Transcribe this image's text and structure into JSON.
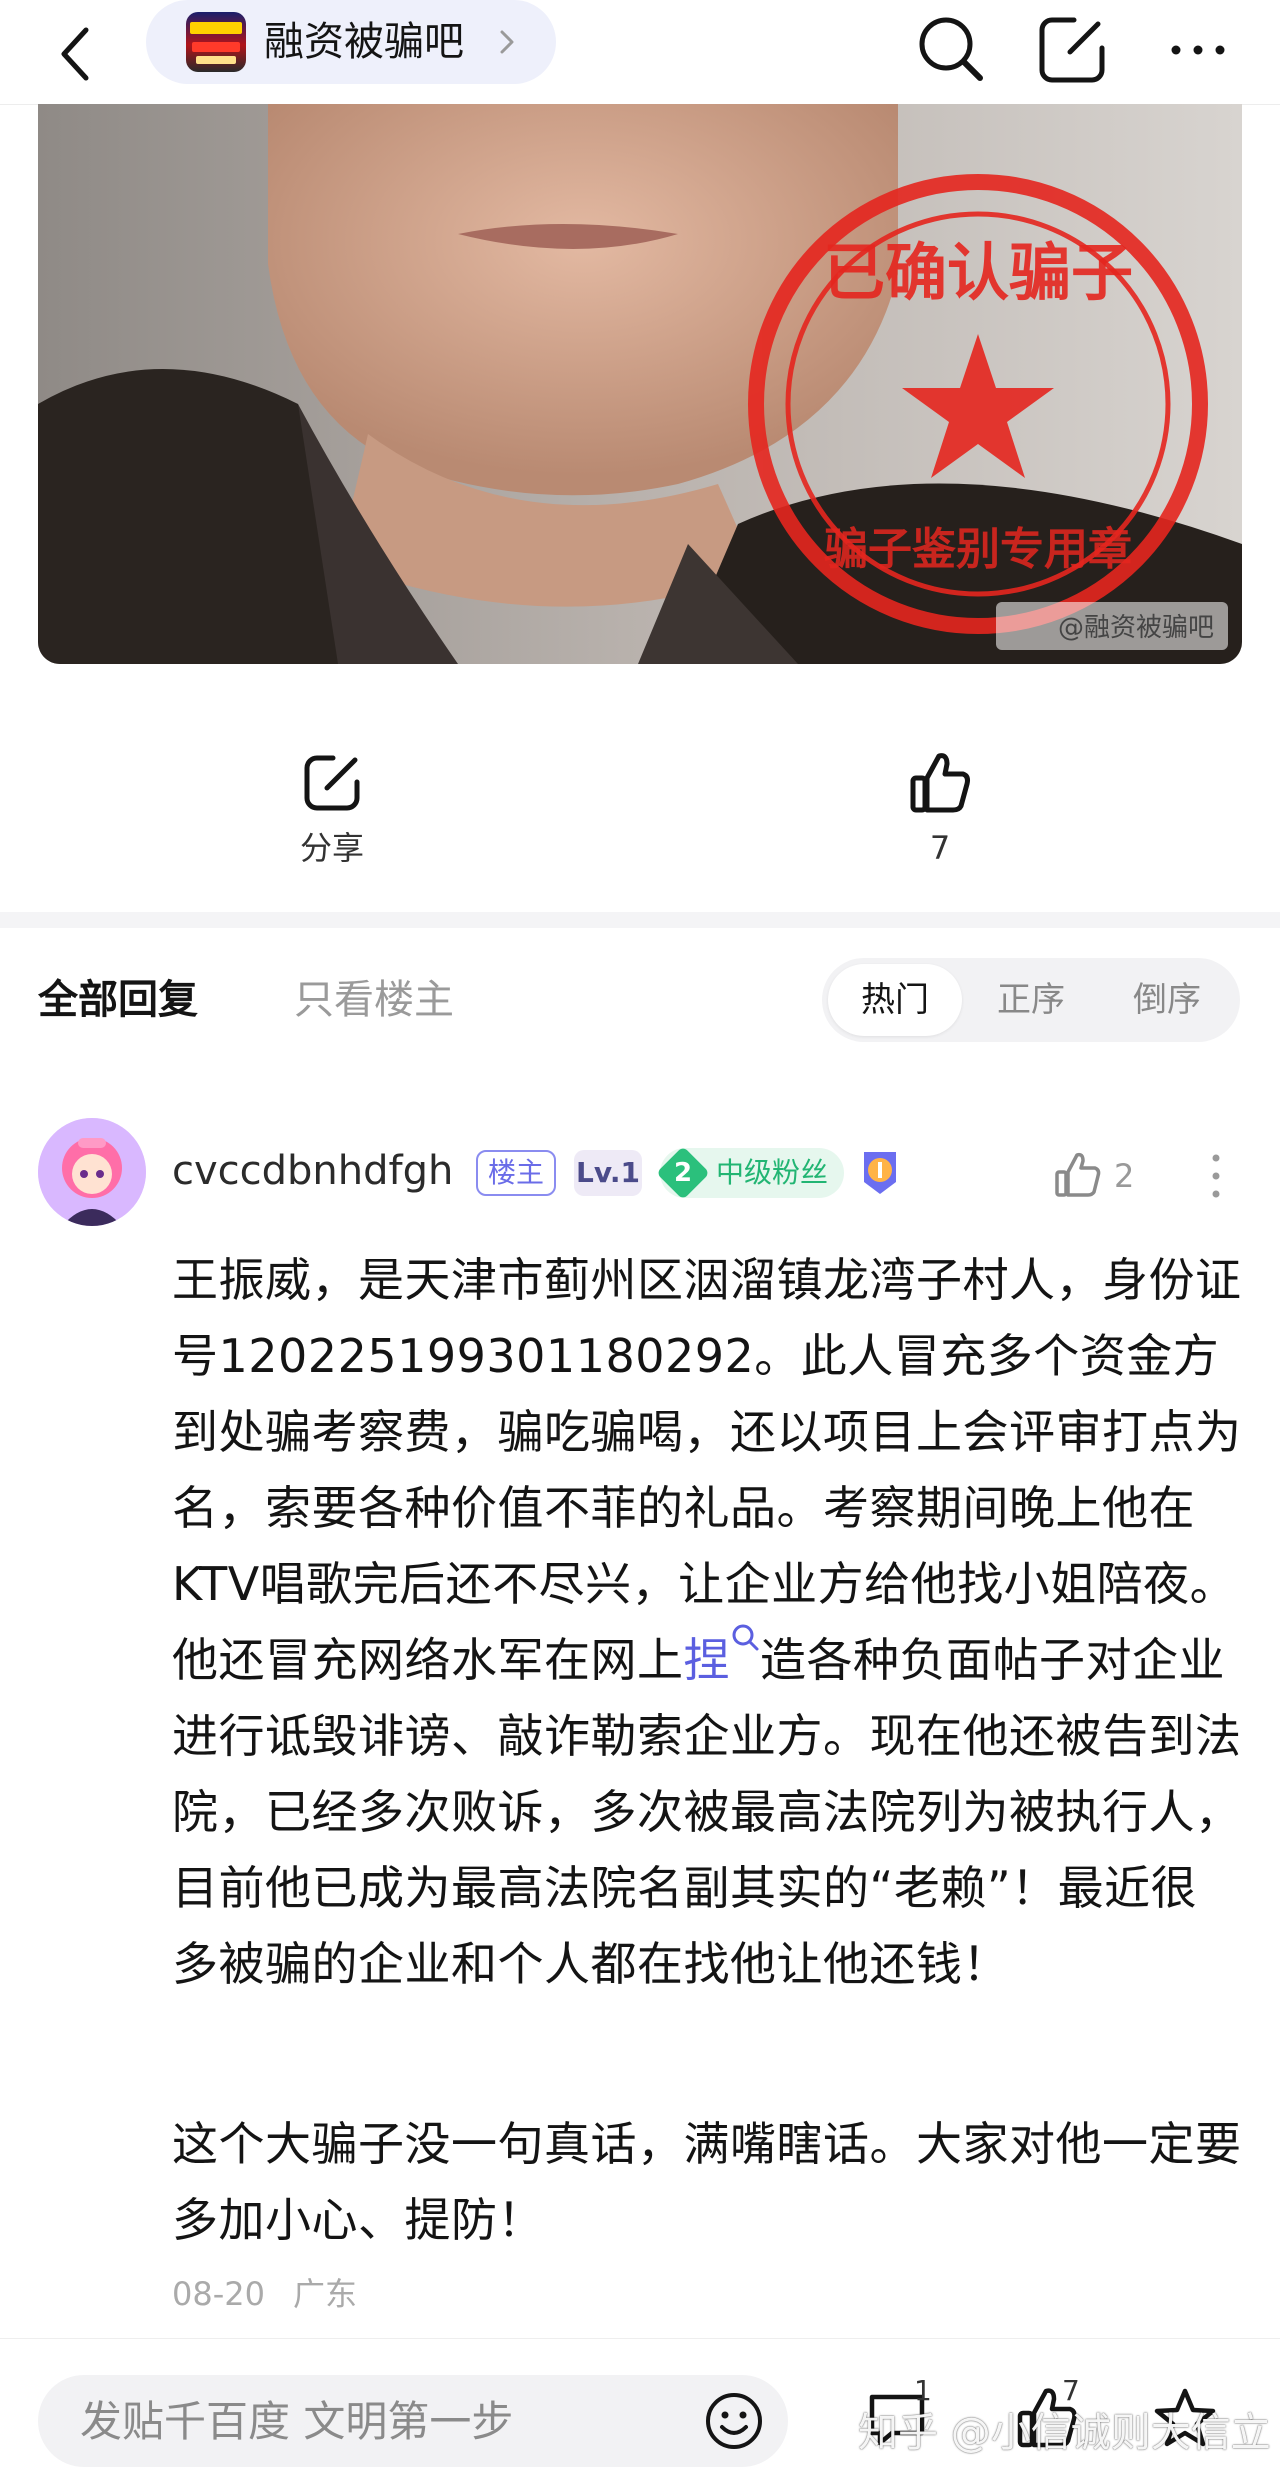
{
  "header": {
    "forum_name": "融资被骗吧"
  },
  "hero": {
    "stamp_top_text": "已确认骗子",
    "stamp_bottom_text": "骗子鉴别专用章",
    "source_mark": "@融资被骗吧"
  },
  "actions": {
    "share_label": "分享",
    "like_count": "7"
  },
  "replies_header": {
    "tab_all": "全部回复",
    "tab_op_only": "只看楼主",
    "sort_options": [
      "热门",
      "正序",
      "倒序"
    ],
    "sort_active": "热门"
  },
  "reply": {
    "username": "cvccdbnhdfgh",
    "badge_op": "楼主",
    "level": "Lv.1",
    "fan_level_num": "2",
    "fan_label": "中级粉丝",
    "like_count": "2",
    "paragraph1": "王振威，是天津市蓟州区洇溜镇龙湾子村人，身份证号120225199301180292。此人冒充多个资金方到处骗考察费，骗吃骗喝，还以项目上会评审打点为名，索要各种价值不菲的礼品。考察期间晚上他在KTV唱歌完后还不尽兴，让企业方给他找小姐陪夜。他还冒充网络水军在网上",
    "paragraph1_link": "捏",
    "paragraph1_rest": "造各种负面帖子对企业进行诋毁诽谤、敲诈勒索企业方。现在他还被告到法院，已经多次败诉，多次被最高法院列为被执行人，目前他已成为最高法院名副其实的“老赖”！最近很多被骗的企业和个人都在找他让他还钱！",
    "paragraph2": "这个大骗子没一句真话，满嘴瞎话。大家对他一定要多加小心、提防！",
    "date": "08-20",
    "location": "广东"
  },
  "bottom_bar": {
    "compose_placeholder": "发贴千百度 文明第一步",
    "comment_count": "1",
    "like_count": "7",
    "watermark": "知乎 @小信诚则大信立"
  },
  "colors": {
    "accent": "#6a6ce8",
    "fan_green": "#22b573",
    "stamp_red": "#e5261f"
  }
}
